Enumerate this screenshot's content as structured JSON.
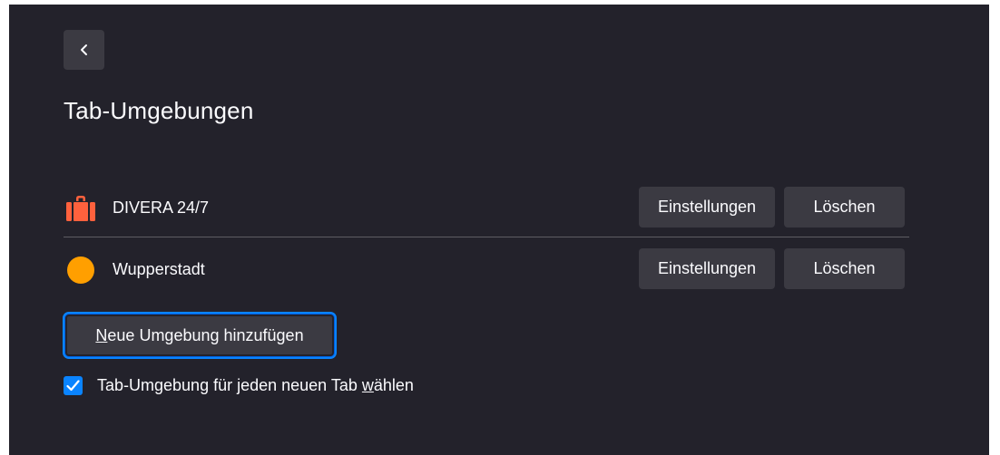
{
  "page": {
    "title": "Tab-Umgebungen",
    "back_icon": "chevron-left-icon"
  },
  "containers": [
    {
      "name": "DIVERA 24/7",
      "icon": "briefcase-icon",
      "color": "#ff613d",
      "settings_label": "Einstellungen",
      "delete_label": "Löschen"
    },
    {
      "name": "Wupperstadt",
      "icon": "circle-icon",
      "color": "#ff9f00",
      "settings_label": "Einstellungen",
      "delete_label": "Löschen"
    }
  ],
  "add_button": {
    "label_accesskey": "N",
    "label_rest": "eue Umgebung hinzufügen"
  },
  "always_ask": {
    "checked": true,
    "label_before": "Tab-Umgebung für jeden neuen Tab ",
    "label_accesskey": "w",
    "label_after": "ählen"
  },
  "colors": {
    "background": "#23222b",
    "button": "#3b3a42",
    "accent": "#0a84ff",
    "text": "#fbfbfe"
  }
}
